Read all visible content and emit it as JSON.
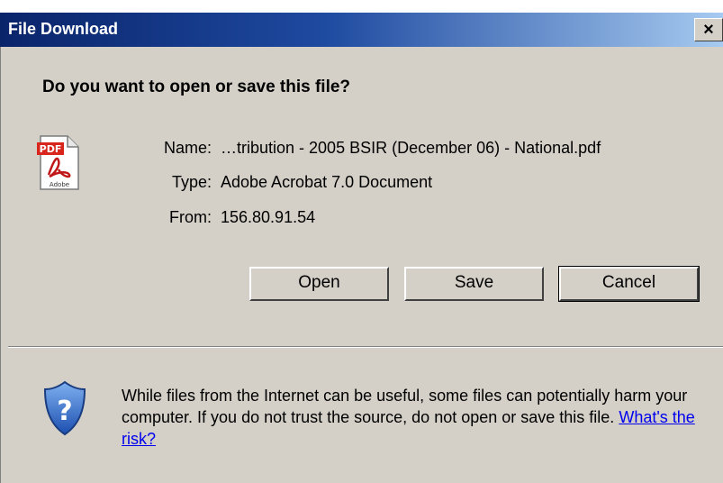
{
  "window": {
    "title": "File Download",
    "close_label": "×"
  },
  "question": "Do you want to open or save this file?",
  "file": {
    "icon": "pdf-file-icon",
    "name_label": "Name:",
    "name_value": "…tribution - 2005 BSIR (December 06) - National.pdf",
    "type_label": "Type:",
    "type_value": "Adobe Acrobat 7.0 Document",
    "from_label": "From:",
    "from_value": "156.80.91.54"
  },
  "buttons": {
    "open": "Open",
    "save": "Save",
    "cancel": "Cancel"
  },
  "warning": {
    "icon": "shield-question-icon",
    "text": "While files from the Internet can be useful, some files can potentially harm your computer. If you do not trust the source, do not open or save this file.",
    "link_text": "What's the risk?"
  },
  "colors": {
    "titlebar_start": "#0a246a",
    "titlebar_end": "#a6caf0",
    "dialog_bg": "#d4d0c8",
    "link": "#0000ee"
  }
}
